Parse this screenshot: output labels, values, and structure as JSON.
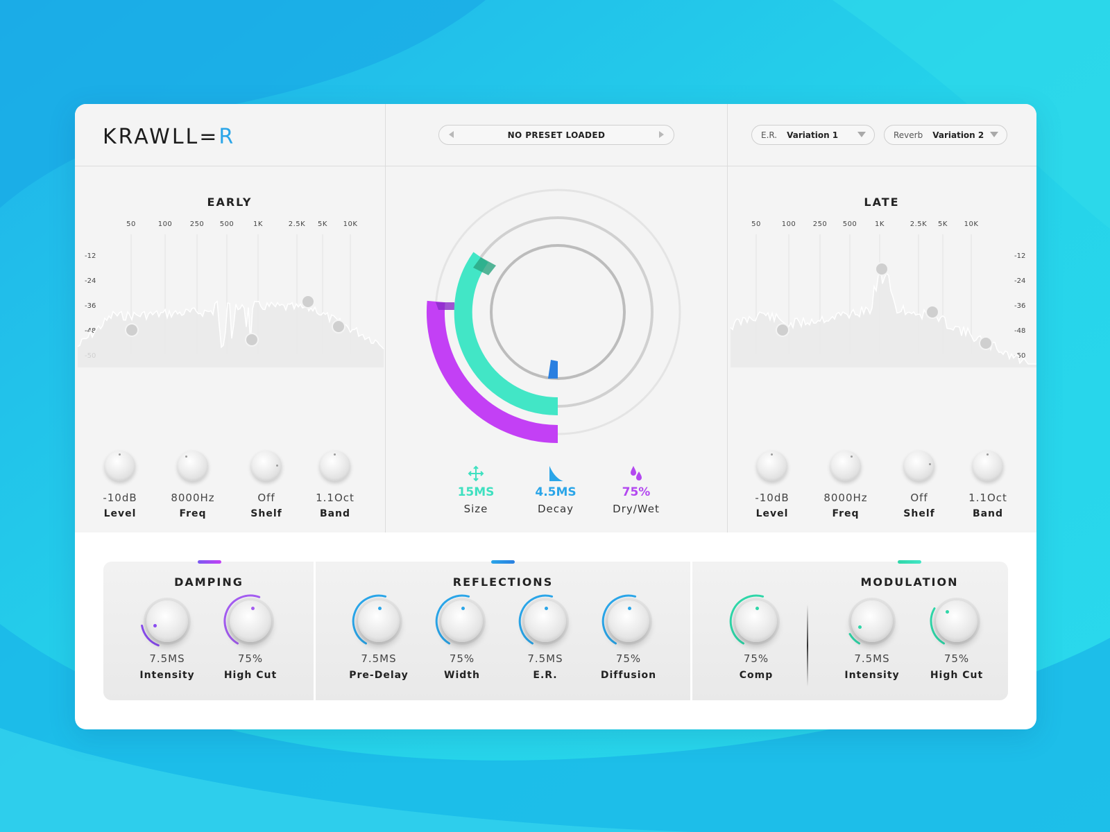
{
  "app": {
    "logo": "KRAWLL",
    "logo_mark": "=",
    "logo_end": "R"
  },
  "header": {
    "preset": "NO PRESET LOADED",
    "er_dropdown": {
      "label": "E.R.",
      "value": "Variation 1"
    },
    "reverb_dropdown": {
      "label": "Reverb",
      "value": "Variation 2"
    }
  },
  "early": {
    "title": "EARLY",
    "freq_labels": [
      "50",
      "100",
      "250",
      "500",
      "1K",
      "2.5K",
      "5K",
      "10K"
    ],
    "db_labels": [
      "-12",
      "-24",
      "-36",
      "-48",
      "-50"
    ],
    "knobs": [
      {
        "value": "-10dB",
        "name": "Level"
      },
      {
        "value": "8000Hz",
        "name": "Freq"
      },
      {
        "value": "Off",
        "name": "Shelf"
      },
      {
        "value": "1.1Oct",
        "name": "Band"
      }
    ]
  },
  "late": {
    "title": "LATE",
    "freq_labels": [
      "50",
      "100",
      "250",
      "500",
      "1K",
      "2.5K",
      "5K",
      "10K"
    ],
    "db_labels": [
      "-12",
      "-24",
      "-36",
      "-48",
      "-50"
    ],
    "knobs": [
      {
        "value": "-10dB",
        "name": "Level"
      },
      {
        "value": "8000Hz",
        "name": "Freq"
      },
      {
        "value": "Off",
        "name": "Shelf"
      },
      {
        "value": "1.1Oct",
        "name": "Band"
      }
    ]
  },
  "center": {
    "stats": [
      {
        "icon": "size-arrows-icon",
        "value": "15MS",
        "name": "Size",
        "color": "#3fe0c0"
      },
      {
        "icon": "decay-icon",
        "value": "4.5MS",
        "name": "Decay",
        "color": "#2aa5e8"
      },
      {
        "icon": "drops-icon",
        "value": "75%",
        "name": "Dry/Wet",
        "color": "#b348f0"
      }
    ],
    "colors": {
      "drywet": "#c340f5",
      "size": "#42e6c6",
      "decay": "#2a7fe0"
    }
  },
  "damping": {
    "title": "DAMPING",
    "accent": "#8a4cf0",
    "knobs": [
      {
        "value": "7.5MS",
        "name": "Intensity"
      },
      {
        "value": "75%",
        "name": "High Cut"
      }
    ]
  },
  "reflections": {
    "title": "REFLECTIONS",
    "accent": "#2aa5e8",
    "knobs": [
      {
        "value": "7.5MS",
        "name": "Pre-Delay"
      },
      {
        "value": "75%",
        "name": "Width"
      },
      {
        "value": "7.5MS",
        "name": "E.R."
      },
      {
        "value": "75%",
        "name": "Diffusion"
      }
    ]
  },
  "modulation": {
    "title": "MODULATION",
    "accent": "#2fd6a8",
    "knobs": [
      {
        "value": "75%",
        "name": "Comp"
      },
      {
        "value": "7.5MS",
        "name": "Intensity"
      },
      {
        "value": "75%",
        "name": "High Cut"
      }
    ]
  }
}
